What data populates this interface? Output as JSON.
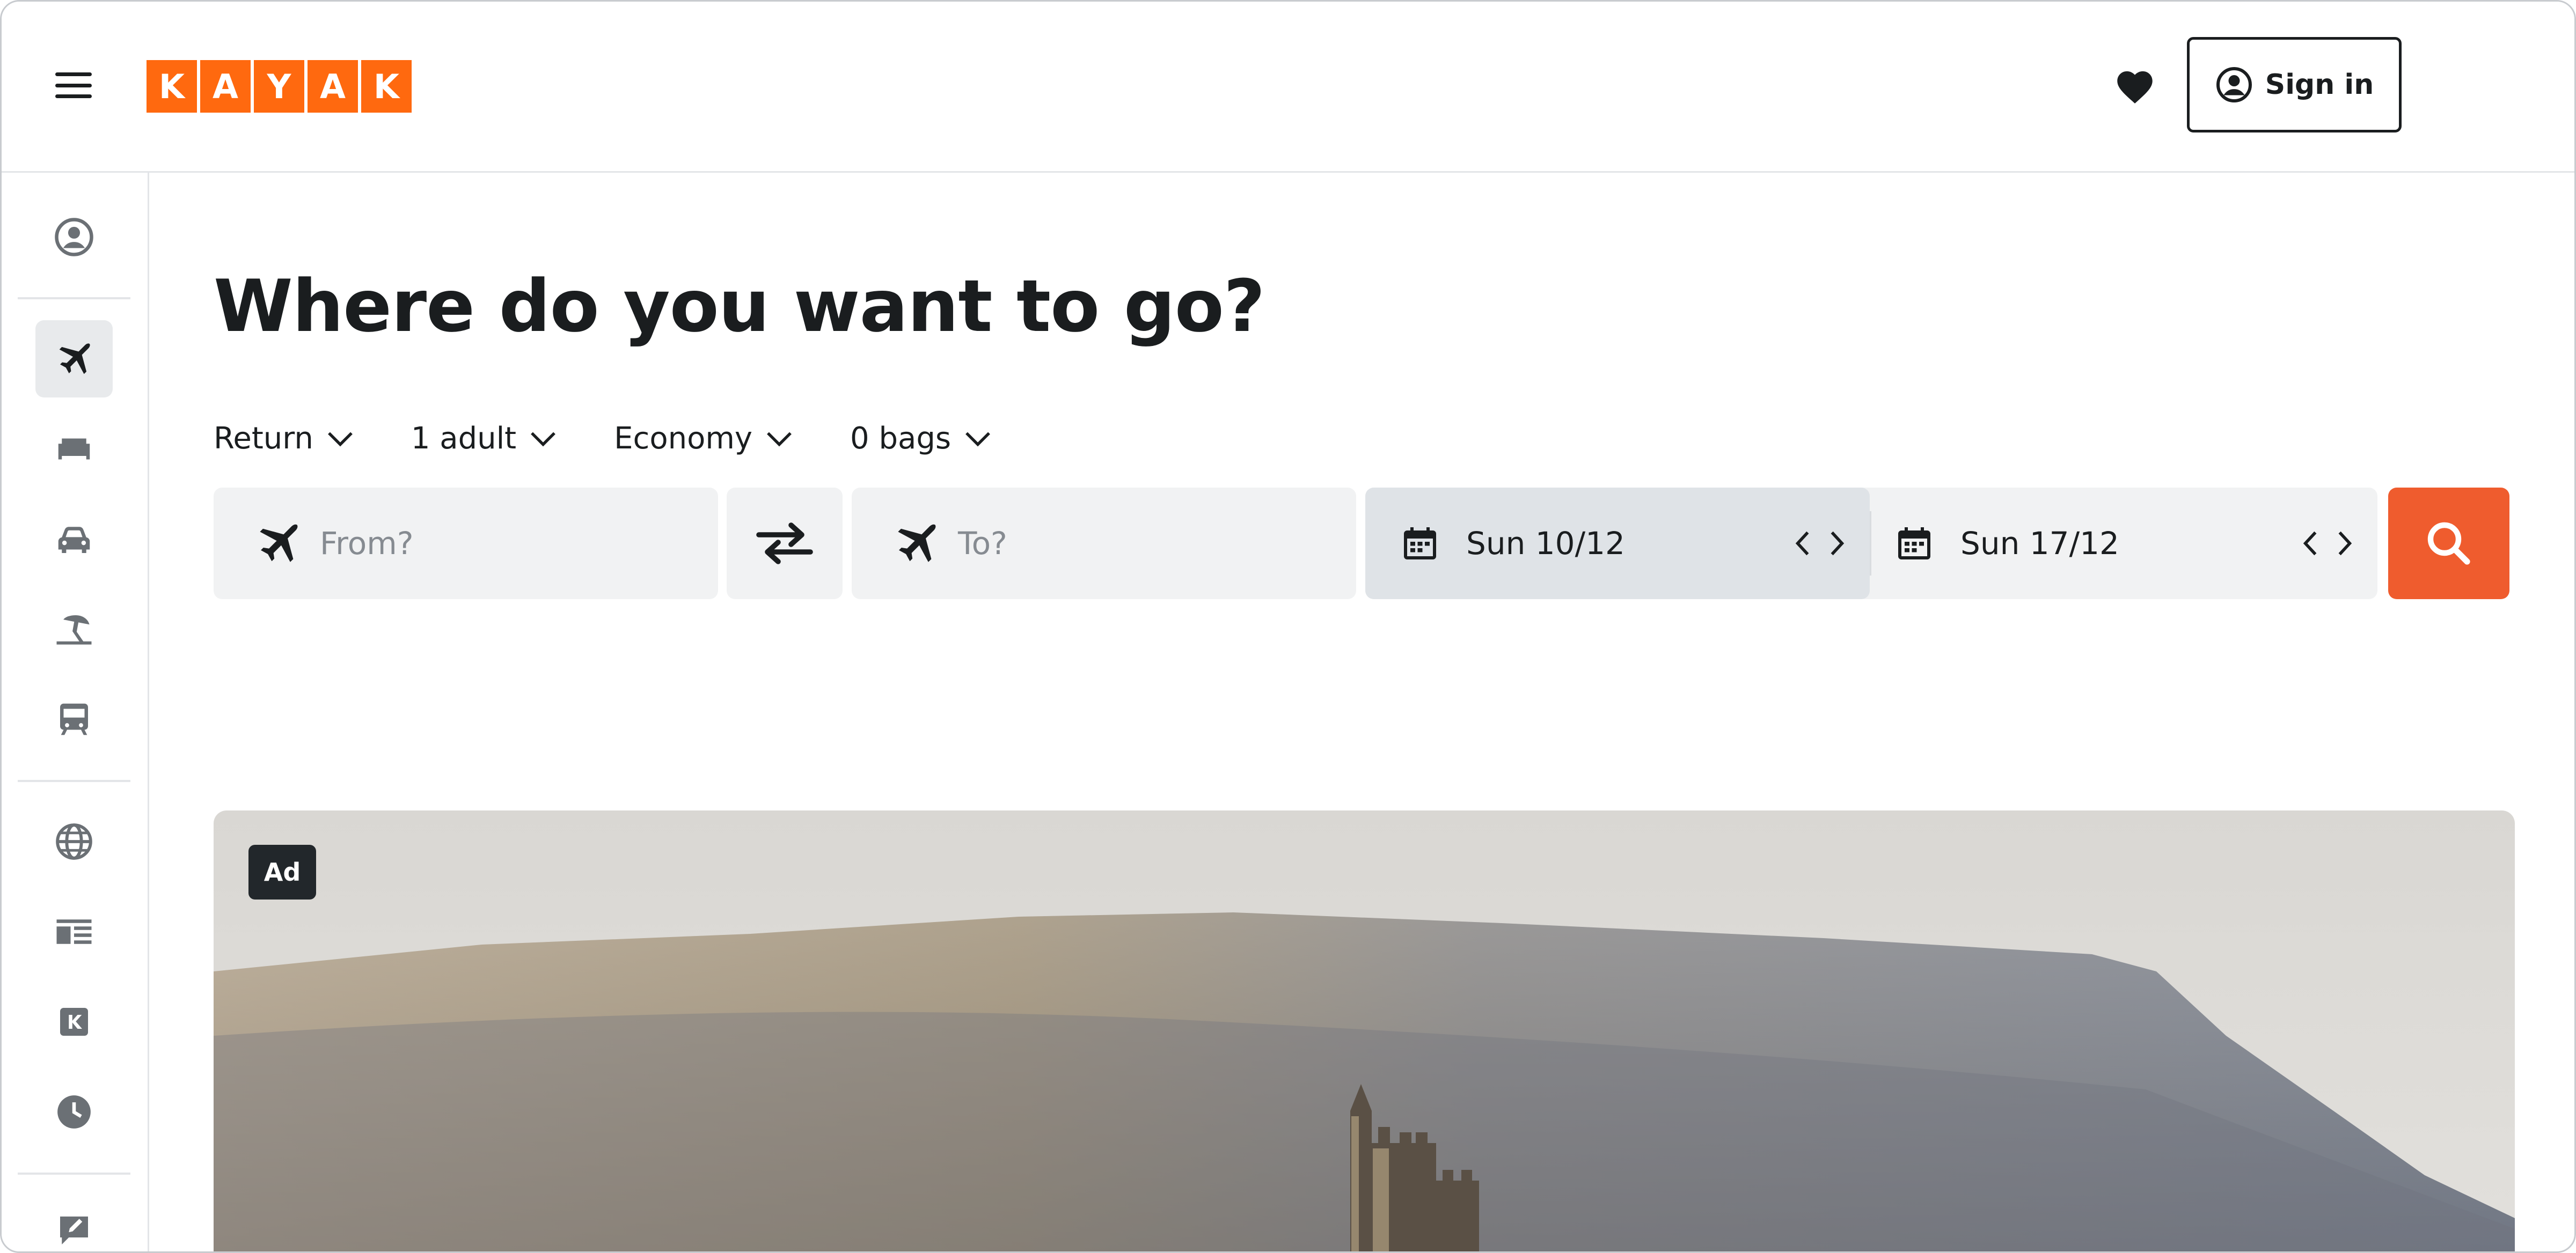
{
  "header": {
    "logo_letters": [
      "K",
      "A",
      "Y",
      "A",
      "K"
    ],
    "sign_in_label": "Sign in",
    "brand_color": "#ff690f"
  },
  "sidebar": {
    "items": [
      {
        "icon": "account-icon"
      },
      {
        "icon": "flight-icon",
        "active": true
      },
      {
        "icon": "bed-icon"
      },
      {
        "icon": "car-icon"
      },
      {
        "icon": "beach-icon"
      },
      {
        "icon": "train-icon"
      },
      {
        "icon": "globe-icon"
      },
      {
        "icon": "news-icon"
      },
      {
        "icon": "kayak-k-icon"
      },
      {
        "icon": "clock-icon"
      },
      {
        "icon": "feedback-icon"
      }
    ]
  },
  "main": {
    "title": "Where do you want to go?",
    "options": {
      "trip_type": "Return",
      "travellers": "1 adult",
      "cabin": "Economy",
      "bags": "0 bags"
    },
    "search": {
      "from_placeholder": "From?",
      "to_placeholder": "To?",
      "depart_date": "Sun 10/12",
      "return_date": "Sun 17/12",
      "button_color": "#ef5c2e"
    },
    "ad_label": "Ad"
  }
}
